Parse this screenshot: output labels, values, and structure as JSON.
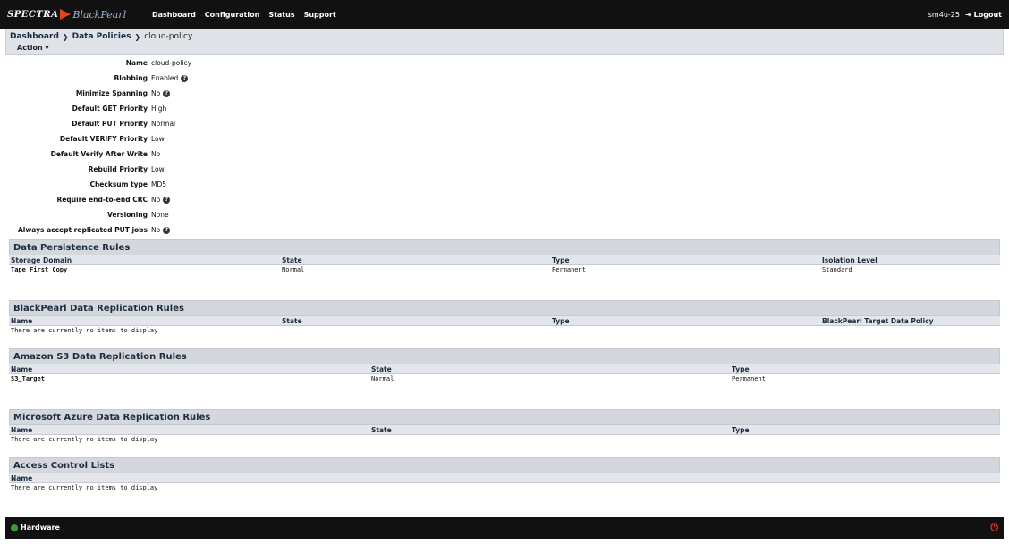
{
  "topbar": {
    "brand_spectra": "SPECTRA",
    "brand_blackpearl": "BlackPearl",
    "nav": [
      "Dashboard",
      "Configuration",
      "Status",
      "Support"
    ],
    "user": "sm4u-25",
    "logout": "Logout"
  },
  "breadcrumb": {
    "items": [
      "Dashboard",
      "Data Policies"
    ],
    "current": "cloud-policy",
    "action": "Action ▾"
  },
  "properties": [
    {
      "label": "Name",
      "value": "cloud-policy",
      "help": false
    },
    {
      "label": "Blobbing",
      "value": "Enabled",
      "help": true
    },
    {
      "label": "Minimize Spanning",
      "value": "No",
      "help": true
    },
    {
      "label": "Default GET Priority",
      "value": "High",
      "help": false
    },
    {
      "label": "Default PUT Priority",
      "value": "Normal",
      "help": false
    },
    {
      "label": "Default VERIFY Priority",
      "value": "Low",
      "help": false
    },
    {
      "label": "Default Verify After Write",
      "value": "No",
      "help": false
    },
    {
      "label": "Rebuild Priority",
      "value": "Low",
      "help": false
    },
    {
      "label": "Checksum type",
      "value": "MD5",
      "help": false
    },
    {
      "label": "Require end-to-end CRC",
      "value": "No",
      "help": true
    },
    {
      "label": "Versioning",
      "value": "None",
      "help": false
    },
    {
      "label": "Always accept replicated PUT jobs",
      "value": "No",
      "help": true
    }
  ],
  "sections": {
    "persistence": {
      "title": "Data Persistence Rules",
      "headers": [
        "Storage Domain",
        "State",
        "Type",
        "Isolation Level"
      ],
      "row": [
        "Tape First Copy",
        "Normal",
        "Permanent",
        "Standard"
      ]
    },
    "blackpearl": {
      "title": "BlackPearl Data Replication Rules",
      "headers": [
        "Name",
        "State",
        "Type",
        "BlackPearl Target Data Policy"
      ],
      "empty": "There are currently no items to display"
    },
    "s3": {
      "title": "Amazon S3 Data Replication Rules",
      "headers": [
        "Name",
        "State",
        "Type"
      ],
      "row": [
        "S3_Target",
        "Normal",
        "Permanent"
      ]
    },
    "azure": {
      "title": "Microsoft Azure Data Replication Rules",
      "headers": [
        "Name",
        "State",
        "Type"
      ],
      "empty": "There are currently no items to display"
    },
    "acl": {
      "title": "Access Control Lists",
      "headers": [
        "Name"
      ],
      "empty": "There are currently no items to display"
    }
  },
  "footer": {
    "hardware": "Hardware"
  },
  "help_glyph": "?",
  "icons": {
    "logout": "logout-icon",
    "help": "question-circle-icon",
    "hardware_status": "check-circle-icon",
    "power": "power-icon"
  },
  "colors": {
    "topbar": "#111111",
    "section_title_bg": "#d4d8dd",
    "accent_orange": "#e0451b",
    "status_green": "#3c9b3c",
    "power_red": "#e53030"
  }
}
